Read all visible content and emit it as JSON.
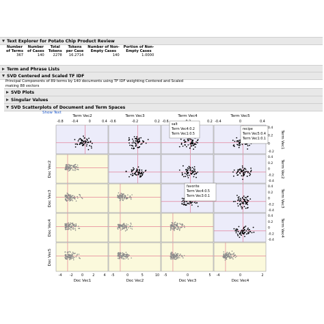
{
  "report": {
    "title": "Text Explorer for Potato Chip Product Review",
    "stats": {
      "headers": [
        "Number of Terms",
        "Number of Cases",
        "Total Tokens",
        "Tokens per Case",
        "Number of Non-Empty Cases",
        "Portion of Non-Empty Cases"
      ],
      "header_lines": [
        [
          "Number",
          "of Terms"
        ],
        [
          "Number",
          "of Cases"
        ],
        [
          "Total",
          "Tokens"
        ],
        [
          "Tokens",
          "per Case"
        ],
        [
          "Number of Non-",
          "Empty Cases"
        ],
        [
          "Portion of Non-",
          "Empty Cases"
        ]
      ],
      "values": [
        "367",
        "140",
        "2278",
        "16.2714",
        "140",
        "1.0000"
      ]
    },
    "section_term_phrase": "Term and Phrase Lists",
    "section_svd": "SVD Centered and Scaled TF IDF",
    "svd_text_1": "Principal Components of 89 terms by 140 documents using TF IDF weighting Centered and Scaled",
    "svd_text_2": "making 88 vectors",
    "section_svd_plots": "SVD Plots",
    "section_singular": "Singular Values",
    "section_scatter": "SVD Scatterplots of Document and Term Spaces",
    "show_text": "Show Text"
  },
  "chart_data": {
    "type": "scatter",
    "title": "SVD Scatterplots of Document and Term Spaces",
    "top_axis_labels": [
      "Term Vec2",
      "Term Vec3",
      "Term Vec4",
      "Term Vec5"
    ],
    "bottom_axis_labels": [
      "Doc Vec1",
      "Doc Vec2",
      "Doc Vec3",
      "Doc Vec4"
    ],
    "left_axis_labels": [
      "Doc Vec2",
      "Doc Vec3",
      "Doc Vec4",
      "Doc Vec5"
    ],
    "right_axis_labels": [
      "Term Vec1",
      "Term Vec2",
      "Term Vec3",
      "Term Vec4"
    ],
    "top_ticks": [
      [
        "-0.8",
        "-0.4",
        "0",
        "0.4"
      ],
      [
        "-0.6",
        "-0.2",
        "0.2"
      ],
      [
        "-0.6",
        "-0.2",
        "0.2"
      ],
      [
        "-0.4",
        "0",
        "0.4"
      ]
    ],
    "bottom_ticks": [
      [
        "-4",
        "-2",
        "0",
        "2",
        "4"
      ],
      [
        "-5",
        "0",
        "5",
        "10"
      ],
      [
        "-5",
        "0",
        "5"
      ],
      [
        "-4",
        "0",
        "2"
      ]
    ],
    "right_ticks": [
      [
        "0.4",
        "0.2",
        "0",
        "-0.2"
      ],
      [
        "0.4",
        "0.2",
        "0",
        "-0.2",
        "-0.4"
      ],
      [
        "0.4",
        "0.2",
        "0",
        "-0.2",
        "-0.4"
      ],
      [
        "0.4",
        "0.2",
        "0",
        "-0.2",
        "-0.4"
      ]
    ],
    "term_color": "#000000",
    "doc_color": "#8c8c8c",
    "term_bg": "#ececfa",
    "doc_bg": "#fbf9dc",
    "ref_line_color": "#e06a86",
    "grid": false
  },
  "tooltips": [
    {
      "title": "salt",
      "lines": [
        "Term Vec4:0.2",
        "Term Vec1:0.5"
      ]
    },
    {
      "title": "recipe",
      "lines": [
        "Term Vec5:0.4",
        "Term Vec1:0.1"
      ]
    },
    {
      "title": "favorite",
      "lines": [
        "Term Vec4:0.5",
        "Term Vec3:0.1"
      ]
    }
  ]
}
